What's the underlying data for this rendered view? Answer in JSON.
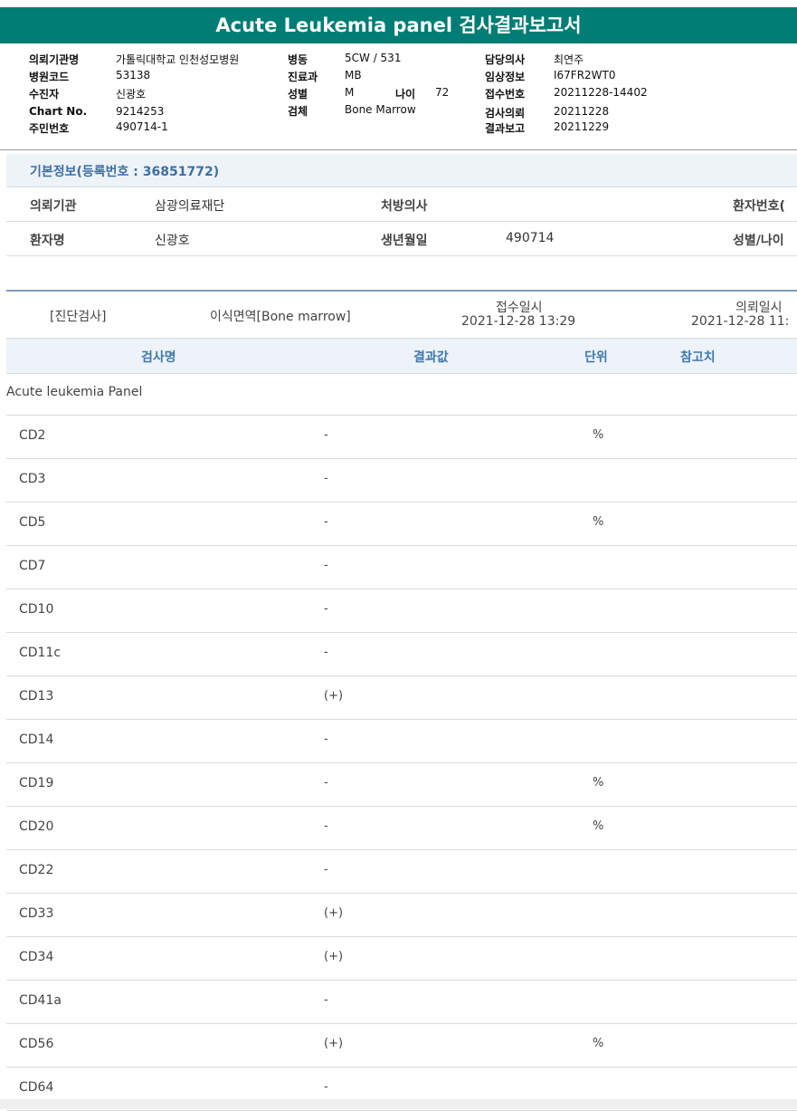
{
  "report_title": "Acute Leukemia panel 검사결과보고서",
  "header": {
    "col1": [
      {
        "label": "의뢰기관명",
        "value": "가톨릭대학교 인천성모병원"
      },
      {
        "label": "병원코드",
        "value": "53138"
      },
      {
        "label": "수진자",
        "value": "신광호"
      },
      {
        "label": "Chart No.",
        "value": "9214253"
      },
      {
        "label": "주민번호",
        "value": "490714-1"
      }
    ],
    "col2": [
      {
        "label": "병동",
        "value": "5CW / 531"
      },
      {
        "label": "진료과",
        "value": "MB"
      },
      {
        "label": "성별",
        "value": "M"
      },
      {
        "label": "검체",
        "value": "Bone Marrow"
      }
    ],
    "age": {
      "label": "나이",
      "value": "72"
    },
    "col3": [
      {
        "label": "담당의사",
        "value": "최연주"
      },
      {
        "label": "임상정보",
        "value": "I67FR2WT0"
      },
      {
        "label": "접수번호",
        "value": "20211228-14402"
      },
      {
        "label": "검사의뢰",
        "value": "20211228"
      },
      {
        "label": "결과보고",
        "value": "20211229"
      }
    ]
  },
  "basic_info": {
    "title": "기본정보(등록번호 : 36851772)",
    "row1": {
      "agency_label": "의뢰기관",
      "agency_value": "삼광의료재단",
      "doctor_label": "처방의사",
      "patient_no_label": "환자번호("
    },
    "row2": {
      "patient_label": "환자명",
      "patient_value": "신광호",
      "birth_label": "생년월일",
      "birth_value": "490714",
      "sex_age_label": "성별/나이"
    }
  },
  "diagnosis": {
    "category": "[진단검사]",
    "test": "이식면역[Bone marrow]",
    "received_label": "접수일시",
    "received_value": "2021-12-28  13:29",
    "requested_label": "의뢰일시",
    "requested_value": "2021-12-28  11:"
  },
  "table": {
    "headers": {
      "name": "검사명",
      "result": "결과값",
      "unit": "단위",
      "ref": "참고치"
    },
    "panel_name": "Acute leukemia Panel",
    "rows": [
      {
        "name": "CD2",
        "result": "-",
        "unit": "%"
      },
      {
        "name": "CD3",
        "result": "-",
        "unit": ""
      },
      {
        "name": "CD5",
        "result": "-",
        "unit": "%"
      },
      {
        "name": "CD7",
        "result": "-",
        "unit": ""
      },
      {
        "name": "CD10",
        "result": "-",
        "unit": ""
      },
      {
        "name": "CD11c",
        "result": "-",
        "unit": ""
      },
      {
        "name": "CD13",
        "result": "(+)",
        "unit": ""
      },
      {
        "name": "CD14",
        "result": "-",
        "unit": ""
      },
      {
        "name": "CD19",
        "result": "-",
        "unit": "%"
      },
      {
        "name": "CD20",
        "result": "-",
        "unit": "%"
      },
      {
        "name": "CD22",
        "result": "-",
        "unit": ""
      },
      {
        "name": "CD33",
        "result": "(+)",
        "unit": ""
      },
      {
        "name": "CD34",
        "result": "(+)",
        "unit": ""
      },
      {
        "name": "CD41a",
        "result": "-",
        "unit": ""
      },
      {
        "name": "CD56",
        "result": "(+)",
        "unit": "%"
      },
      {
        "name": "CD64",
        "result": "-",
        "unit": ""
      }
    ]
  },
  "colors": {
    "title_bar": "#007d74",
    "section_title": "#3c6fa5",
    "table_header": "#3f78ad"
  }
}
